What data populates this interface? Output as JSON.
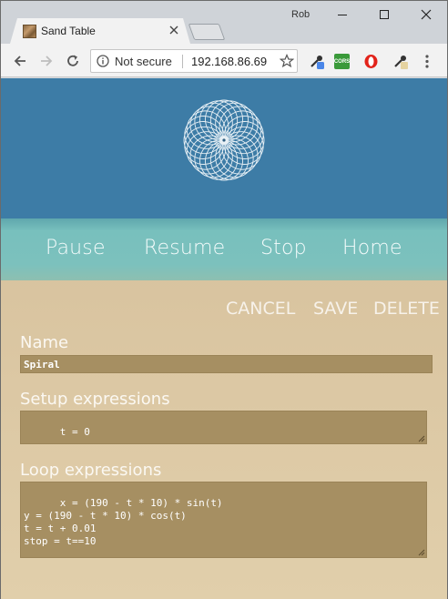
{
  "browser": {
    "profile_name": "Rob",
    "tab": {
      "title": "Sand Table"
    },
    "omnibox": {
      "security_text": "Not secure",
      "url": "192.168.86.69"
    },
    "extensions": {
      "cors_label": "CORS"
    }
  },
  "controls": {
    "pause": "Pause",
    "resume": "Resume",
    "stop": "Stop",
    "home": "Home"
  },
  "actions": {
    "cancel": "CANCEL",
    "save": "SAVE",
    "delete": "DELETE"
  },
  "form": {
    "name_label": "Name",
    "name_value": "Spiral",
    "setup_label": "Setup expressions",
    "setup_value": "t = 0",
    "loop_label": "Loop expressions",
    "loop_value": "x = (190 - t * 10) * sin(t)\ny = (190 - t * 10) * cos(t)\nt = t + 0.01\nstop = t==10"
  },
  "colors": {
    "header": "#3d7ca6",
    "control_band": "#7cc1bd",
    "sand": "#d6c19c",
    "field_bg": "#a68f62"
  }
}
